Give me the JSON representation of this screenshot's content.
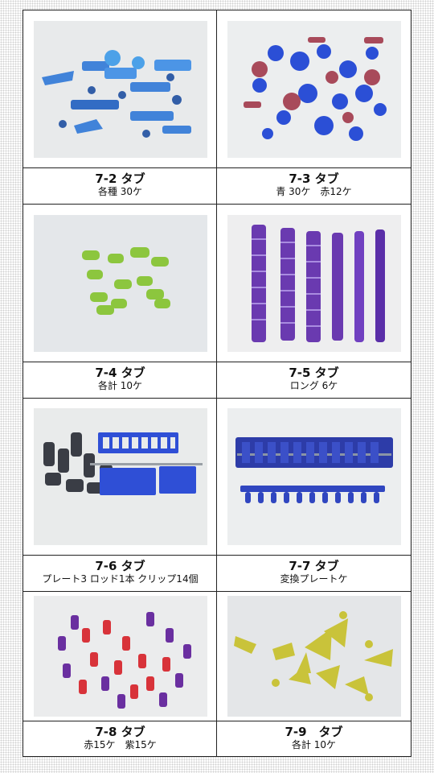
{
  "items": [
    {
      "title": "7-2 タブ",
      "detail": "各種 30ケ"
    },
    {
      "title": "7-3 タブ",
      "detail": "青 30ケ　赤12ケ"
    },
    {
      "title": "7-4 タブ",
      "detail": "各計 10ケ"
    },
    {
      "title": "7-5 タブ",
      "detail": "ロング 6ケ"
    },
    {
      "title": "7-6 タブ",
      "detail": "プレート3 ロッド1本 クリップ14個"
    },
    {
      "title": "7-7 タブ",
      "detail": "変換プレートケ"
    },
    {
      "title": "7-8 タブ",
      "detail": "赤15ケ　紫15ケ"
    },
    {
      "title": "7-9　タブ",
      "detail": "各計 10ケ"
    }
  ],
  "colors": {
    "blue_tab": "#2f6fd0",
    "purple_tab": "#6a3ab0",
    "green_tab": "#8cc63e",
    "red_tab": "#d8333a",
    "yellow_tab": "#c9c33a",
    "dark_clip": "#3a3d45"
  }
}
